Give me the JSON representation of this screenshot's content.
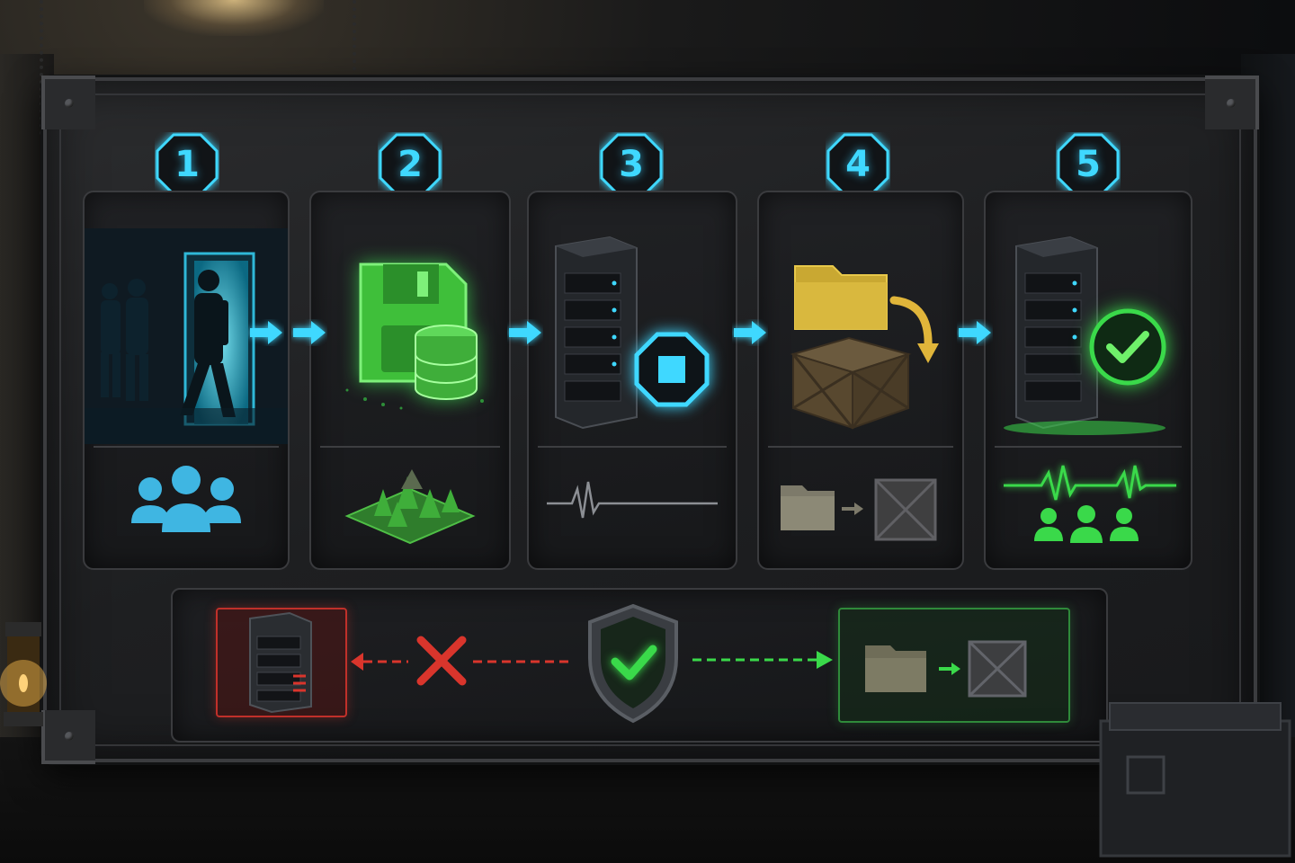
{
  "colors": {
    "accent_cyan": "#3fd8ff",
    "accent_green": "#3ad94a",
    "accent_yellow": "#d9a92a",
    "danger_red": "#d9352c",
    "panel_bg": "#1c1d20"
  },
  "steps": [
    {
      "number": "1",
      "art_icon": "people-walking-through-door-icon",
      "sub_icon": "group-users-icon"
    },
    {
      "number": "2",
      "art_icon": "save-disk-database-icon",
      "sub_icon": "forest-map-icon"
    },
    {
      "number": "3",
      "art_icon": "server-stop-icon",
      "sub_icon": "flat-heartbeat-icon"
    },
    {
      "number": "4",
      "art_icon": "folder-into-crate-icon",
      "sub_icon": "folder-arrow-crate-icon"
    },
    {
      "number": "5",
      "art_icon": "server-check-icon",
      "sub_icon": "heartbeat-users-icon"
    }
  ],
  "bottom": {
    "left_icon": "server-error-icon",
    "blocked_icon": "red-x-icon",
    "center_icon": "shield-check-icon",
    "right_icon": "folder-to-crate-icon"
  }
}
